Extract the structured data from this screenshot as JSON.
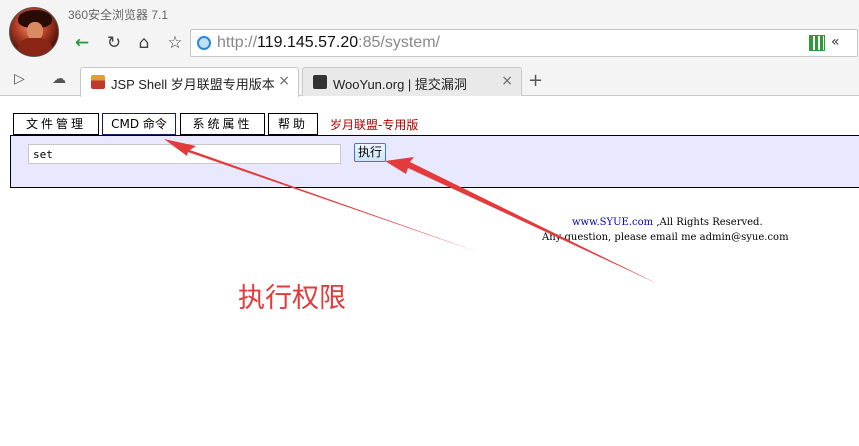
{
  "browser": {
    "app_title": "360安全浏览器 7.1",
    "url_scheme": "http://",
    "url_host": "119.145.57.20",
    "url_rest": ":85/system/",
    "more_glyph": "«",
    "new_tab_glyph": "+",
    "tabs": [
      {
        "label": "JSP Shell 岁月联盟专用版本",
        "active": true
      },
      {
        "label": "WooYun.org | 提交漏洞",
        "active": false
      }
    ],
    "close_glyph": "×"
  },
  "page": {
    "menu": {
      "files": "文件管理",
      "cmd": "CMD 命令",
      "system": "系统属性",
      "help": "帮助"
    },
    "brand": "岁月联盟-专用版",
    "command_value": "set",
    "execute_label": "执行",
    "footer_link": "www.SYUE.com",
    "footer_rights": " ,All Rights Reserved.",
    "footer_contact": "Any question, please email me admin@syue.com"
  },
  "annotation": {
    "text": "执行权限",
    "color": "#e33b3b"
  },
  "colors": {
    "panel_bg": "#e8e8ff",
    "brand_red": "#b00000",
    "nav_green": "#2e9a3f"
  },
  "icons": [
    "back-arrow-icon",
    "reload-icon",
    "home-icon",
    "star-icon",
    "globe-icon",
    "qr-code-icon",
    "sidebar-toggle-icon",
    "cloud-icon",
    "close-icon",
    "new-tab-icon"
  ]
}
